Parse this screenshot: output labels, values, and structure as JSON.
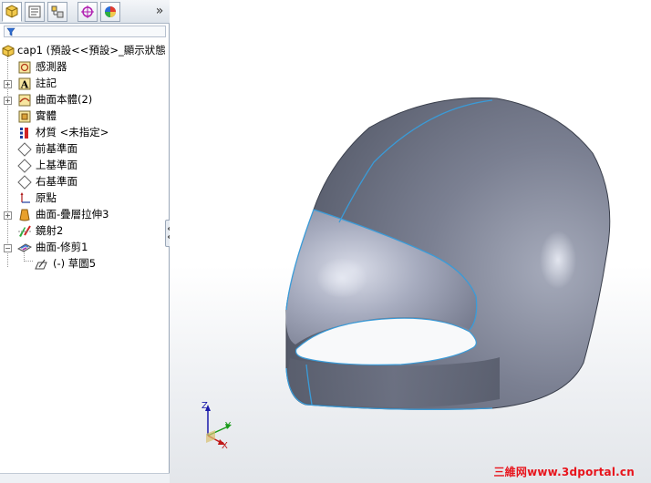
{
  "colors": {
    "panel_bg": "#ffffff",
    "helmet_body": "#6b7081",
    "helmet_edge": "#3a9bd8",
    "watermark": "#e8141c",
    "axis_y": "#1a9b1a",
    "axis_z": "#1a1aaa",
    "axis_x": "#c01818"
  },
  "tabs": [
    {
      "icon": "feature-manager-icon"
    },
    {
      "icon": "property-manager-icon"
    },
    {
      "icon": "configuration-manager-icon"
    },
    {
      "icon": "dimxpert-icon"
    },
    {
      "icon": "display-manager-icon"
    }
  ],
  "tab_more_label": "»",
  "tree": {
    "root": "cap1 (預設<<預設>_顯示狀態",
    "items": [
      {
        "label": "感測器",
        "icon": "sensor-icon"
      },
      {
        "label": "註記",
        "icon": "annotation-icon"
      },
      {
        "label": "曲面本體(2)",
        "icon": "surface-bodies-icon"
      },
      {
        "label": "實體",
        "icon": "solid-bodies-icon"
      },
      {
        "label": "材質 <未指定>",
        "icon": "material-icon"
      },
      {
        "label": "前基準面",
        "icon": "plane-icon"
      },
      {
        "label": "上基準面",
        "icon": "plane-icon"
      },
      {
        "label": "右基準面",
        "icon": "plane-icon"
      },
      {
        "label": "原點",
        "icon": "origin-icon"
      },
      {
        "label": "曲面-疊層拉伸3",
        "icon": "loft-surface-icon"
      },
      {
        "label": "鏡射2",
        "icon": "mirror-icon"
      },
      {
        "label": "曲面-修剪1",
        "icon": "trim-surface-icon"
      },
      {
        "label": "(-) 草圖5",
        "icon": "sketch-icon"
      }
    ]
  },
  "triad": {
    "z": "Z",
    "y": "Y",
    "x": "X"
  },
  "watermark": "三維网www.3dportal.cn"
}
